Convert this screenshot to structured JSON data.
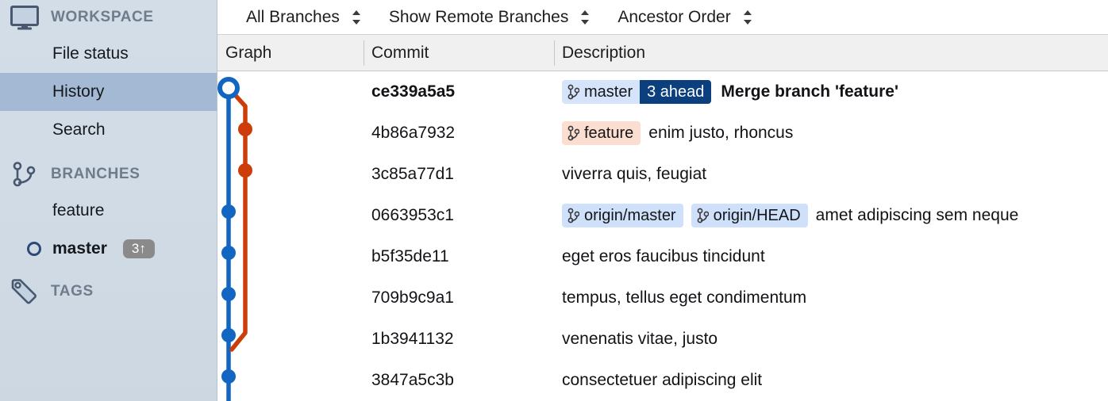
{
  "sidebar": {
    "sections": [
      {
        "id": "workspace",
        "label": "WORKSPACE",
        "icon": "monitor-icon"
      },
      {
        "id": "branches",
        "label": "BRANCHES",
        "icon": "git-branch-icon"
      },
      {
        "id": "tags",
        "label": "TAGS",
        "icon": "tag-icon"
      }
    ],
    "workspace_items": [
      {
        "label": "File status",
        "selected": false
      },
      {
        "label": "History",
        "selected": true
      },
      {
        "label": "Search",
        "selected": false
      }
    ],
    "branch_items": [
      {
        "label": "feature",
        "current": false,
        "badge": null
      },
      {
        "label": "master",
        "current": true,
        "badge": "3↑"
      }
    ]
  },
  "toolbar": {
    "filters": [
      {
        "id": "branch-filter",
        "value": "All Branches"
      },
      {
        "id": "remote-filter",
        "value": "Show Remote Branches"
      },
      {
        "id": "order-filter",
        "value": "Ancestor Order"
      }
    ]
  },
  "table": {
    "columns": [
      "Graph",
      "Commit",
      "Description"
    ],
    "rows": [
      {
        "hash": "ce339a5a5",
        "description": "Merge branch 'feature'",
        "bold": true,
        "refs": [
          {
            "name": "master",
            "type": "local",
            "ahead": "3 ahead"
          }
        ]
      },
      {
        "hash": "4b86a7932",
        "description": "enim justo, rhoncus",
        "bold": false,
        "refs": [
          {
            "name": "feature",
            "type": "feature",
            "ahead": null
          }
        ]
      },
      {
        "hash": "3c85a77d1",
        "description": "viverra quis, feugiat",
        "bold": false,
        "refs": []
      },
      {
        "hash": "0663953c1",
        "description": "amet adipiscing sem neque",
        "bold": false,
        "refs": [
          {
            "name": "origin/master",
            "type": "remote",
            "ahead": null
          },
          {
            "name": "origin/HEAD",
            "type": "remote",
            "ahead": null
          }
        ]
      },
      {
        "hash": "b5f35de11",
        "description": "eget eros faucibus tincidunt",
        "bold": false,
        "refs": []
      },
      {
        "hash": "709b9c9a1",
        "description": "tempus, tellus eget condimentum",
        "bold": false,
        "refs": []
      },
      {
        "hash": "1b3941132",
        "description": "venenatis vitae, justo",
        "bold": false,
        "refs": []
      },
      {
        "hash": "3847a5c3b",
        "description": "consectetuer adipiscing elit",
        "bold": false,
        "refs": []
      }
    ]
  },
  "graph": {
    "lane_colors": {
      "master": "#1266c2",
      "feature": "#cc3d09"
    },
    "nodes": [
      {
        "row": 0,
        "lane": "master",
        "style": "ring"
      },
      {
        "row": 1,
        "lane": "feature",
        "style": "filled"
      },
      {
        "row": 2,
        "lane": "feature",
        "style": "filled"
      },
      {
        "row": 3,
        "lane": "master",
        "style": "filled"
      },
      {
        "row": 4,
        "lane": "master",
        "style": "filled"
      },
      {
        "row": 5,
        "lane": "master",
        "style": "filled"
      },
      {
        "row": 6,
        "lane": "master",
        "style": "filled"
      },
      {
        "row": 7,
        "lane": "master",
        "style": "filled"
      }
    ]
  },
  "colors": {
    "sidebar_bg": "#d2dce6",
    "sidebar_selected": "#a3b9d4",
    "header_bg": "#f0f0f0",
    "accent_blue": "#1266c2",
    "accent_red": "#cc3d09",
    "badge_navy": "#0c3f7d",
    "ref_local_bg": "#d6e4fb",
    "ref_remote_bg": "#cfe0fb",
    "ref_feature_bg": "#fbdecf",
    "sidebar_badge_bg": "#8a8a8a"
  }
}
